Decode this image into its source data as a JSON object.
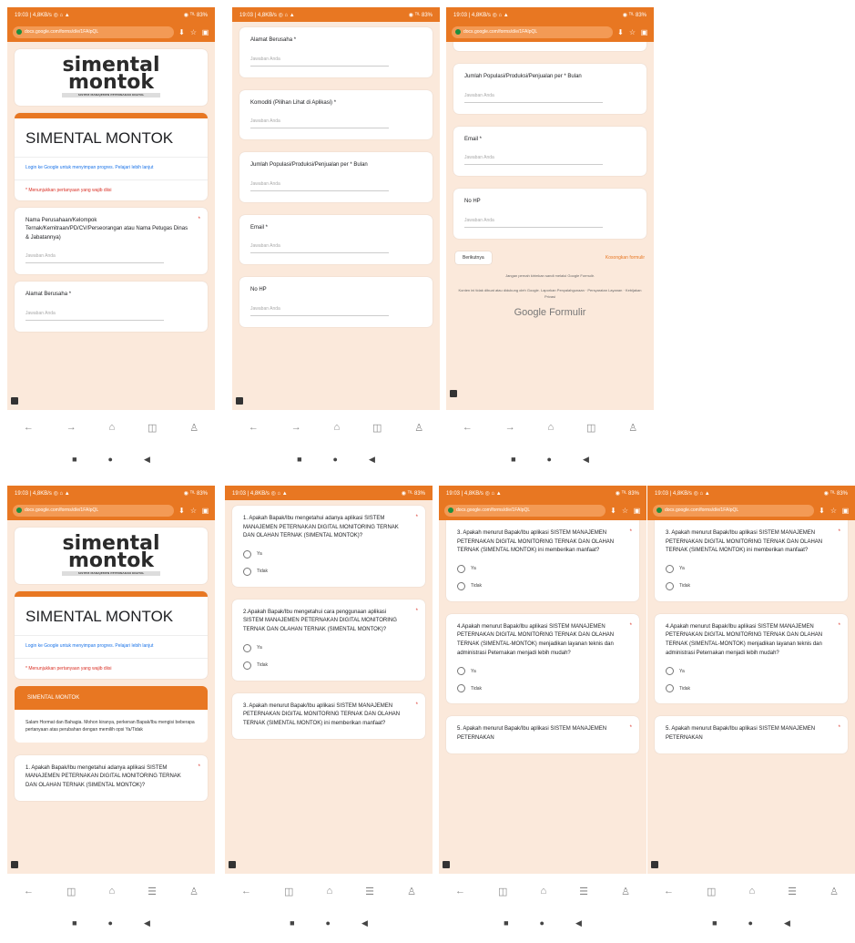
{
  "status": {
    "time_left": "19:03 | 4,8KB/s ◎ ⌂ ▲",
    "time_right": "◉ ᵀᴵᴸ 83%"
  },
  "browser": {
    "url": "docs.google.com/forms/d/e/1FAIpQL"
  },
  "logo": {
    "line1": "simental",
    "line2": "montok",
    "tagline": "SISTEM MANAJEMEN PETERNAKAN DIGITAL"
  },
  "form": {
    "title": "SIMENTAL MONTOK",
    "login_note": "Login ke Google untuk menyimpan progres. Pelajari lebih lanjut",
    "required_note": "* Menunjukkan pertanyaan yang wajib diisi",
    "answer_placeholder": "Jawaban Anda",
    "required_star": "*",
    "q_nama": "Nama Perusahaan/Kelompok Ternak/Kemitraan/PD/CV/Perseorangan atau Nama Petugas Dinas & Jabatannya)",
    "q_alamat": "Alamat Berusaha *",
    "q_komoditi": "Komoditi (Pilihan Lihat di Aplikasi) *",
    "q_jumlah": "Jumlah Populasi/Produksi/Penjualan per * Bulan",
    "q_email": "Email *",
    "q_hp": "No HP",
    "submit": "Berikutnya",
    "clear": "Kosongkan formulir",
    "footer1": "Jangan pernah kirimkan sandi melalui Google Formulir.",
    "footer2": "Konten ini tidak dibuat atau didukung oleh Google. Laporkan Penyalahgunaan · Persyaratan Layanan · Kebijakan Privasi",
    "gforms": "Google Formulir"
  },
  "section": {
    "title": "SIMENTAL MONTOK",
    "body": "Salam Hormat dan Bahagia. Mohon kiranya, perkenan Bapak/Ibu mengisi beberapa pertanyaan atas perubahan dengan memilih opsi Ya/Tidak"
  },
  "questions": {
    "q1": "1. Apakah Bapak/Ibu mengetahui adanya aplikasi SISTEM MANAJEMEN PETERNAKAN DIGITAL MONITORING TERNAK DAN OLAHAN TERNAK (SIMENTAL MONTOK)?",
    "q2": "2.Apakah Bapak/Ibu mengetahui cara penggunaan aplikasi SISTEM MANAJEMEN PETERNAKAN DIGITAL MONITORING TERNAK DAN OLAHAN TERNAK (SIMENTAL MONTOK)?",
    "q3": "3. Apakah menurut Bapak/Ibu aplikasi SISTEM MANAJEMEN PETERNAKAN DIGITAL MONITORING TERNAK DAN OLAHAN TERNAK (SIMENTAL MONTOK) ini memberikan manfaat?",
    "q4": "4.Apakah menurut Bapak/Ibu aplikasi SISTEM MANAJEMEN PETERNAKAN DIGITAL MONITORING TERNAK DAN OLAHAN TERNAK (SIMENTAL-MONTOK) menjadikan layanan teknis dan administrasi Peternakan menjadi lebih mudah?",
    "q5": "5. Apakah menurut Bapak/Ibu aplikasi SISTEM MANAJEMEN PETERNAKAN",
    "opt_yes": "Ya",
    "opt_no": "Tidak"
  },
  "nav": {
    "back": "←",
    "forward": "→",
    "tabs": "◫",
    "home": "⌂",
    "menu": "☰",
    "profile": "♙"
  },
  "sys": {
    "recent": "■",
    "home": "●",
    "back": "◀"
  },
  "icons": {
    "star": "☆",
    "download": "⬇",
    "bookmark": "▣"
  }
}
